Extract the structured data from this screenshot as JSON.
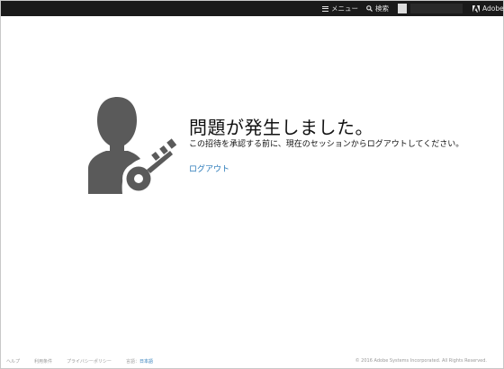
{
  "header": {
    "menu_label": "メニュー",
    "search_label": "検索",
    "brand": "Adobe"
  },
  "error": {
    "title": "問題が発生しました。",
    "message": "この招待を承認する前に、現在のセッションからログアウトしてください。",
    "logout_link": "ログアウト"
  },
  "footer": {
    "links": [
      "ヘルプ",
      "利用条件",
      "プライバシーポリシー"
    ],
    "language_label": "言語：",
    "language_value": "日本語",
    "copyright": "© 2016 Adobe Systems Incorporated. All Rights Reserved."
  },
  "colors": {
    "topbar": "#1a1a1a",
    "link": "#2a7ab9",
    "icon": "#5a5a5a"
  }
}
